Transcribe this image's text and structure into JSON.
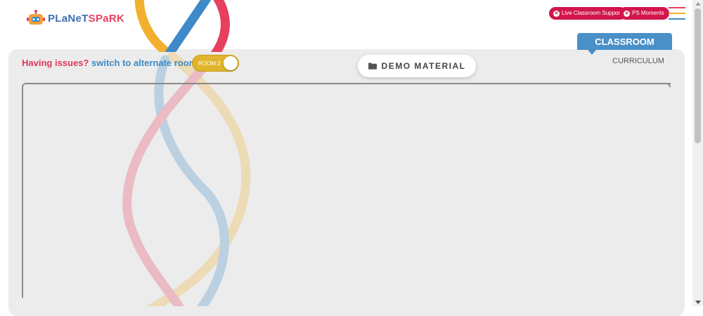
{
  "brand": {
    "logo_part1": "PLaNeT",
    "logo_part2": "SPaRK"
  },
  "header": {
    "live_support_label": "Live Classroom Support",
    "ps_moments_label": "PS Moments",
    "menu_icon": "hamburger-icon"
  },
  "tabs": {
    "classroom_label": "CLASSROOM",
    "curriculum_label": "CURRICULUM"
  },
  "room_switch": {
    "issue_text": "Having issues?",
    "switch_text": "switch to alternate room",
    "toggle_label": "ROOM 2"
  },
  "demo_material": {
    "label": "DEMO MATERIAL",
    "icon": "folder-icon"
  },
  "colors": {
    "accent_red": "#d0164a",
    "accent_blue": "#4a90c8",
    "toggle_yellow": "#e0b42c",
    "panel_bg": "#ececec"
  }
}
